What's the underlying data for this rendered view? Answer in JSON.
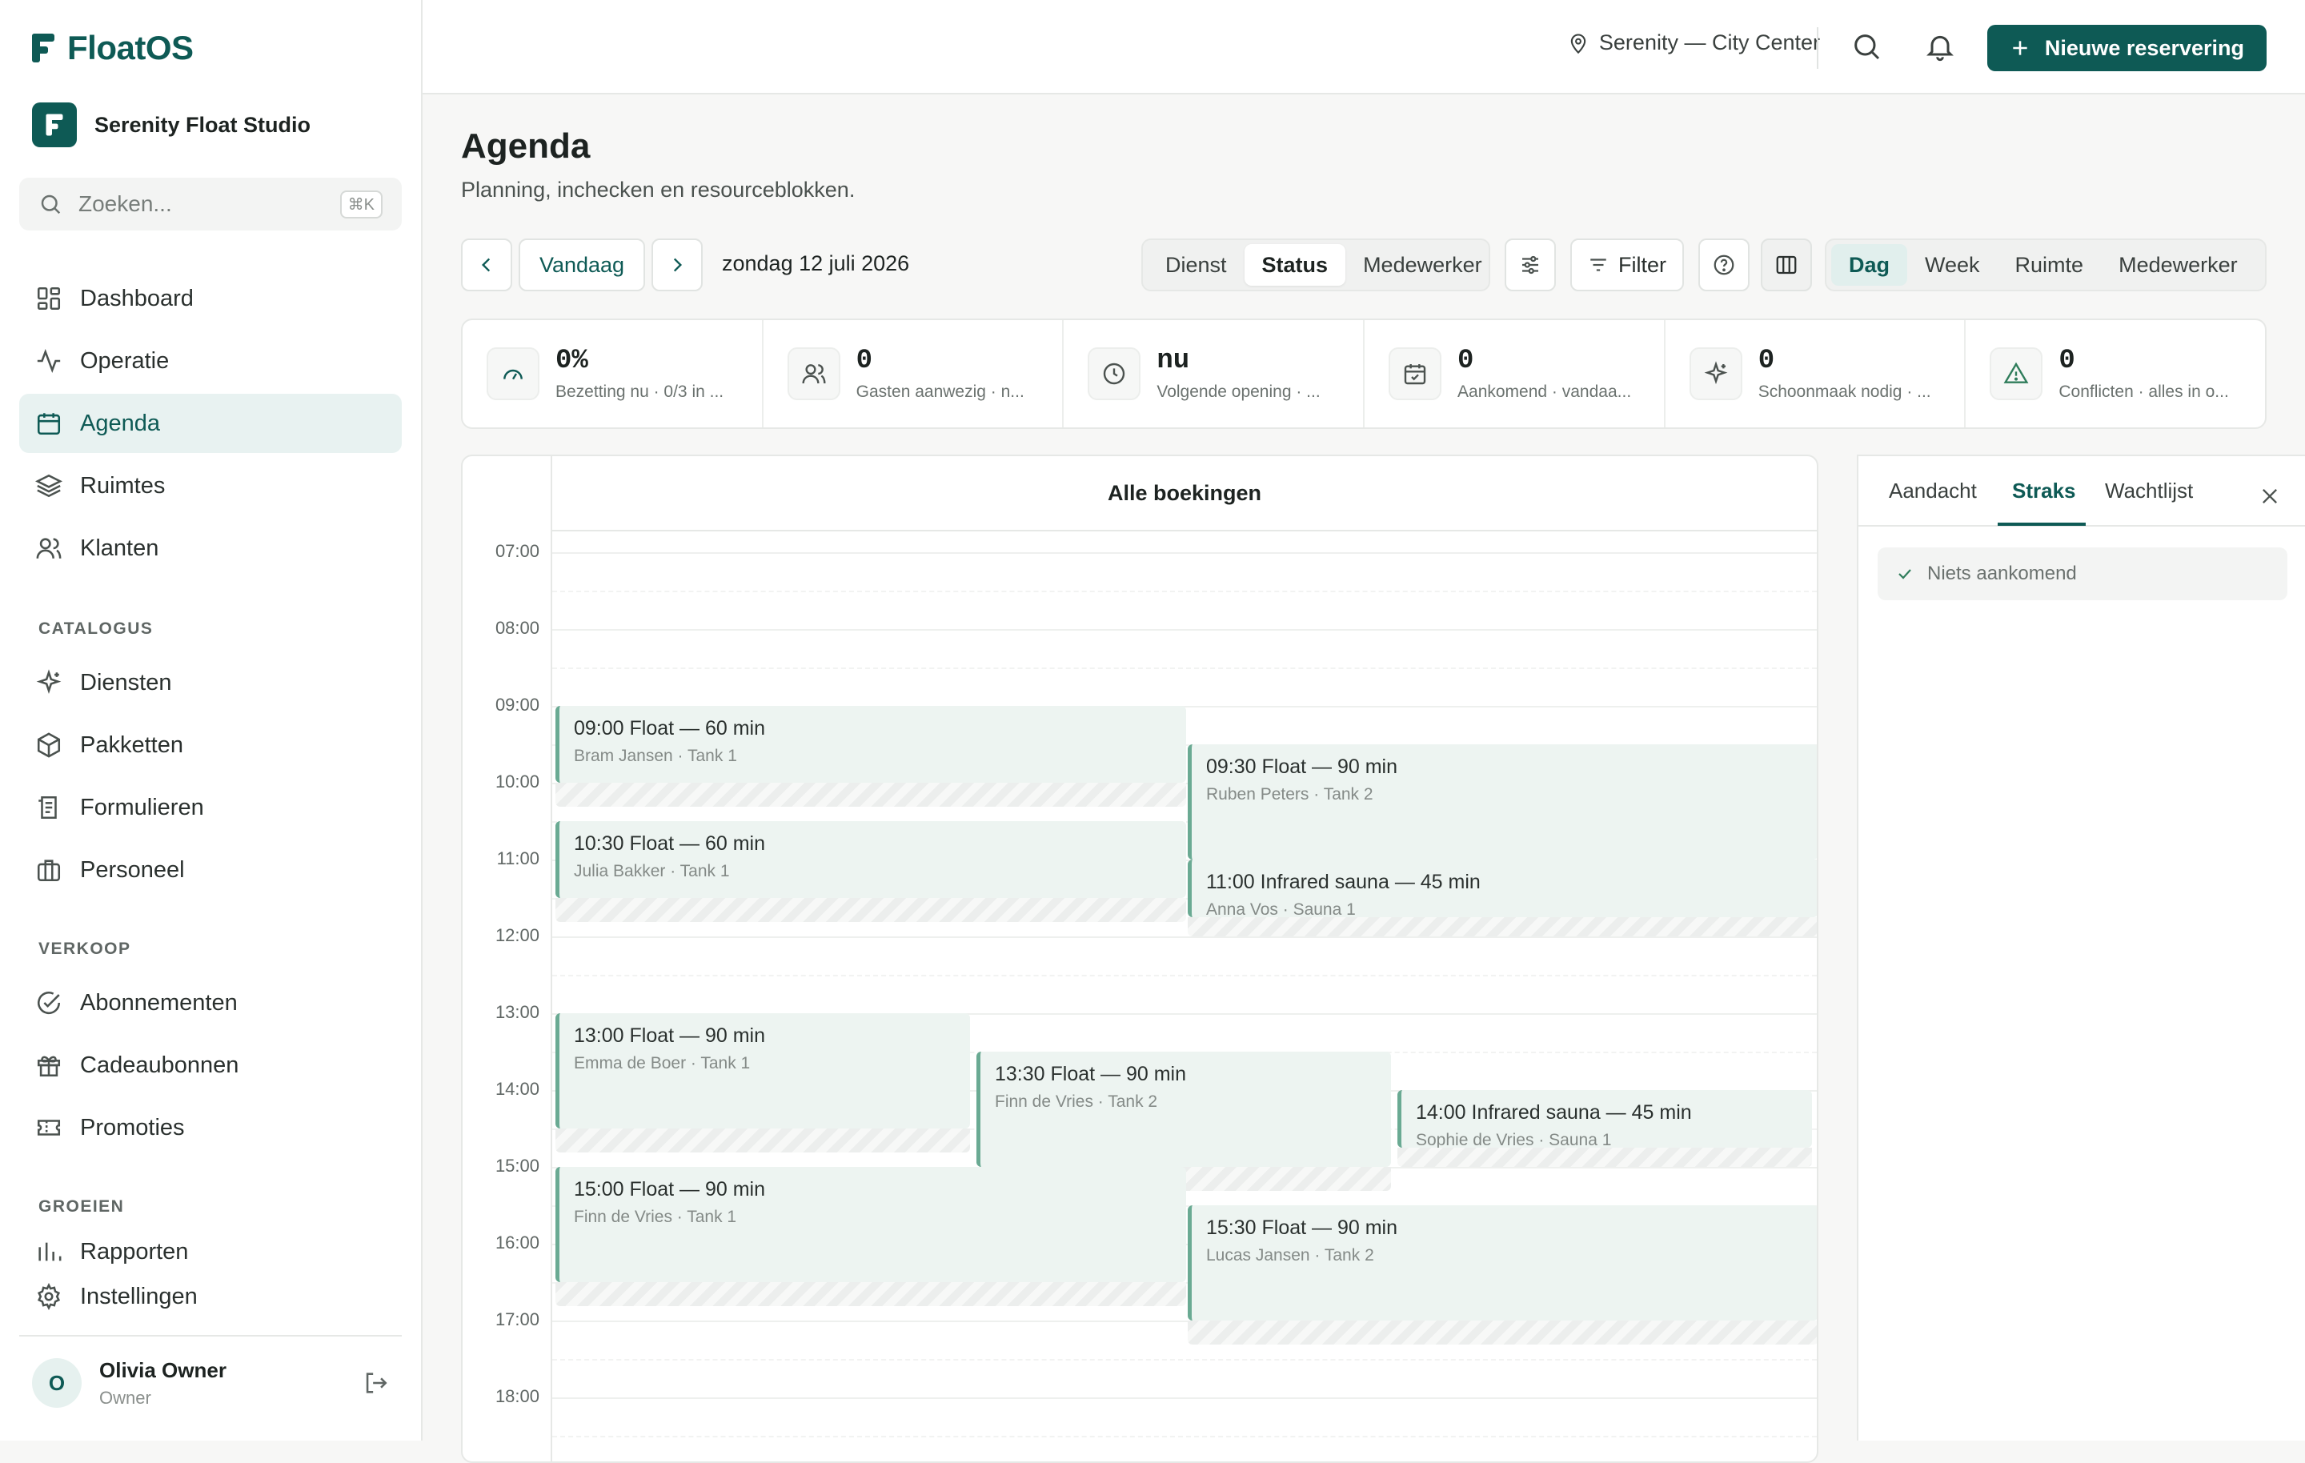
{
  "app": {
    "name": "FloatOS"
  },
  "studio": {
    "name": "Serenity Float Studio"
  },
  "search": {
    "placeholder": "Zoeken...",
    "shortcut": "⌘K"
  },
  "nav": {
    "main": [
      {
        "label": "Dashboard",
        "icon": "dashboard-icon"
      },
      {
        "label": "Operatie",
        "icon": "activity-icon"
      },
      {
        "label": "Agenda",
        "icon": "calendar-icon",
        "active": true
      },
      {
        "label": "Ruimtes",
        "icon": "layers-icon"
      },
      {
        "label": "Klanten",
        "icon": "users-icon"
      }
    ],
    "catalogus_title": "CATALOGUS",
    "catalogus": [
      {
        "label": "Diensten",
        "icon": "sparkle-icon"
      },
      {
        "label": "Pakketten",
        "icon": "package-icon"
      },
      {
        "label": "Formulieren",
        "icon": "form-icon"
      },
      {
        "label": "Personeel",
        "icon": "briefcase-icon"
      }
    ],
    "verkoop_title": "VERKOOP",
    "verkoop": [
      {
        "label": "Abonnementen",
        "icon": "check-circle-icon"
      },
      {
        "label": "Cadeaubonnen",
        "icon": "gift-icon"
      },
      {
        "label": "Promoties",
        "icon": "ticket-icon"
      }
    ],
    "groeien_title": "GROEIEN",
    "groeien": [
      {
        "label": "Rapporten",
        "icon": "bar-chart-icon"
      },
      {
        "label": "Instellingen",
        "icon": "gear-icon"
      }
    ]
  },
  "user": {
    "initial": "O",
    "name": "Olivia Owner",
    "role": "Owner"
  },
  "topbar": {
    "location": "Serenity — City Center",
    "new_booking": "Nieuwe reservering"
  },
  "page": {
    "title": "Agenda",
    "subtitle": "Planning, inchecken en resourceblokken."
  },
  "toolbar": {
    "today": "Vandaag",
    "date": "zondag 12 juli 2026",
    "group_by": [
      "Dienst",
      "Status",
      "Medewerker"
    ],
    "group_by_active": "Status",
    "filter": "Filter",
    "views": [
      "Dag",
      "Week",
      "Ruimte",
      "Medewerker"
    ],
    "view_active": "Dag"
  },
  "stats": [
    {
      "value": "0%",
      "label": "Bezetting nu · 0/3 in ...",
      "icon": "gauge-icon"
    },
    {
      "value": "0",
      "label": "Gasten aanwezig · n...",
      "icon": "users-icon"
    },
    {
      "value": "nu",
      "label": "Volgende opening · ...",
      "icon": "clock-icon"
    },
    {
      "value": "0",
      "label": "Aankomend · vandaa...",
      "icon": "calendar-check-icon"
    },
    {
      "value": "0",
      "label": "Schoonmaak nodig · ...",
      "icon": "sparkle-icon"
    },
    {
      "value": "0",
      "label": "Conflicten · alles in o...",
      "icon": "warning-icon"
    }
  ],
  "calendar": {
    "column_title": "Alle boekingen",
    "hours": [
      "07:00",
      "08:00",
      "09:00",
      "10:00",
      "11:00",
      "12:00",
      "13:00",
      "14:00",
      "15:00",
      "16:00",
      "17:00",
      "18:00"
    ],
    "events": [
      {
        "title": "09:00 Float — 60 min",
        "meta": "Bram Jansen · Tank 1",
        "start": "09:00",
        "end": "10:00",
        "buffer_end": "10:30"
      },
      {
        "title": "09:30 Float — 90 min",
        "meta": "Ruben Peters · Tank 2",
        "start": "09:30",
        "end": "11:00"
      },
      {
        "title": "10:30 Float — 60 min",
        "meta": "Julia Bakker · Tank 1",
        "start": "10:30",
        "end": "11:30",
        "buffer_end": "12:00"
      },
      {
        "title": "11:00 Infrared sauna — 45 min",
        "meta": "Anna Vos · Sauna 1",
        "start": "11:00",
        "end": "11:45",
        "buffer_end": "12:00"
      },
      {
        "title": "13:00 Float — 90 min",
        "meta": "Emma de Boer · Tank 1",
        "start": "13:00",
        "end": "14:30",
        "buffer_end": "15:00"
      },
      {
        "title": "13:30 Float — 90 min",
        "meta": "Finn de Vries · Tank 2",
        "start": "13:30",
        "end": "15:00",
        "buffer_end": "15:30"
      },
      {
        "title": "14:00 Infrared sauna — 45 min",
        "meta": "Sophie de Vries · Sauna 1",
        "start": "14:00",
        "end": "14:45",
        "buffer_end": "15:00"
      },
      {
        "title": "15:00 Float — 90 min",
        "meta": "Finn de Vries · Tank 1",
        "start": "15:00",
        "end": "16:30",
        "buffer_end": "17:00"
      },
      {
        "title": "15:30 Float — 90 min",
        "meta": "Lucas Jansen · Tank 2",
        "start": "15:30",
        "end": "17:00",
        "buffer_end": "17:30"
      }
    ]
  },
  "panel": {
    "tabs": [
      "Aandacht",
      "Straks",
      "Wachtlijst"
    ],
    "active_tab": "Straks",
    "empty": "Niets aankomend"
  },
  "colors": {
    "brand": "#0e5a55",
    "event_bg": "#edf4f1",
    "event_border": "#6aaa93"
  }
}
